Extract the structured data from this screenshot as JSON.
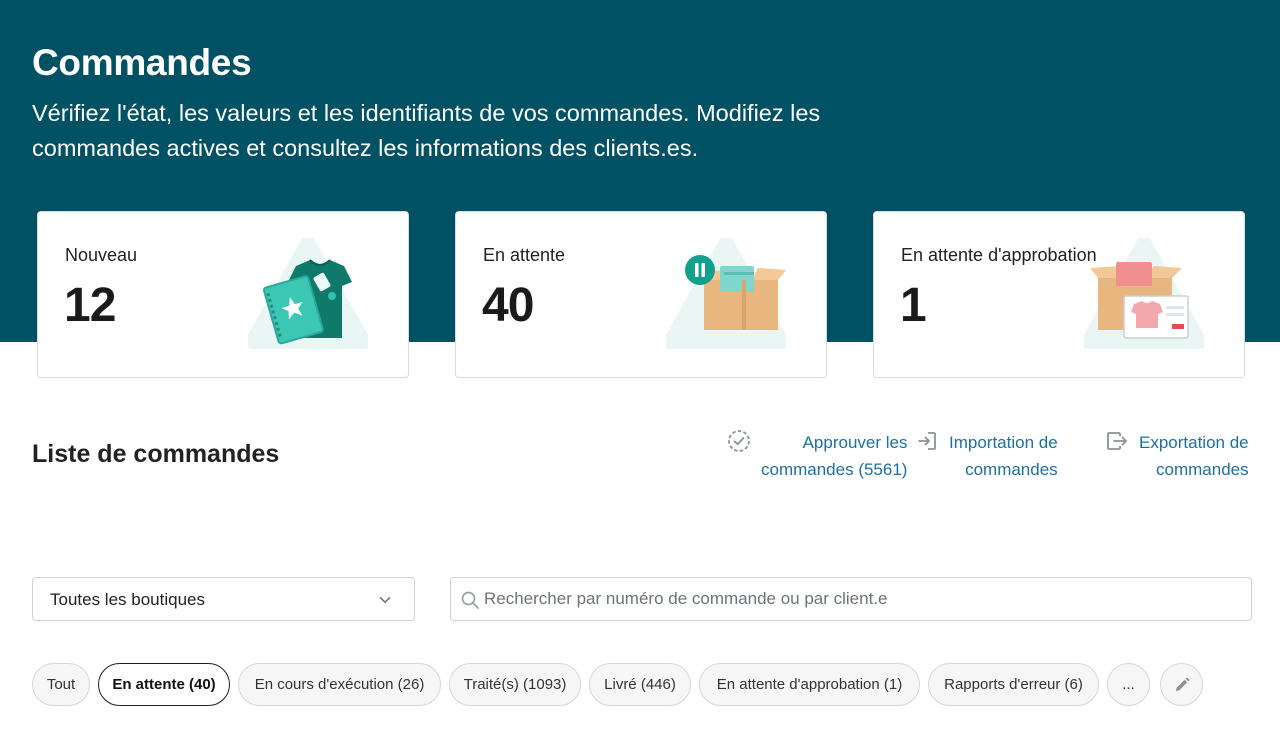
{
  "header": {
    "title": "Commandes",
    "description": "Vérifiez l'état, les valeurs et les identifiants de vos commandes. Modifiez les commandes actives et consultez les informations des clients.es."
  },
  "stats": [
    {
      "label": "Nouveau",
      "value": "12",
      "illustration": "tshirt-notebook-illustration"
    },
    {
      "label": "En attente",
      "value": "40",
      "illustration": "paused-box-illustration"
    },
    {
      "label": "En attente d'approbation",
      "value": "1",
      "illustration": "box-with-tshirt-card-illustration"
    }
  ],
  "order_list": {
    "title": "Liste de commandes",
    "actions": [
      {
        "line1": "Approuver les",
        "line2": "commandes (5561)",
        "icon": "approve-check-icon"
      },
      {
        "line1": "Importation de",
        "line2": "commandes",
        "icon": "import-icon"
      },
      {
        "line1": "Exportation de",
        "line2": "commandes",
        "icon": "export-icon"
      }
    ]
  },
  "filters": {
    "store_select": "Toutes les boutiques",
    "search_placeholder": "Rechercher par numéro de commande ou par client.e"
  },
  "tabs": [
    {
      "label": "Tout",
      "active": false
    },
    {
      "label": "En attente (40)",
      "active": true
    },
    {
      "label": "En cours d'exécution (26)",
      "active": false
    },
    {
      "label": "Traité(s) (1093)",
      "active": false
    },
    {
      "label": "Livré (446)",
      "active": false
    },
    {
      "label": "En attente d'approbation (1)",
      "active": false
    },
    {
      "label": "Rapports d'erreur (6)",
      "active": false
    },
    {
      "label": "...",
      "active": false
    }
  ],
  "colors": {
    "header_bg": "#005163",
    "link": "#1d6fa5",
    "accent_teal": "#16a38f"
  }
}
